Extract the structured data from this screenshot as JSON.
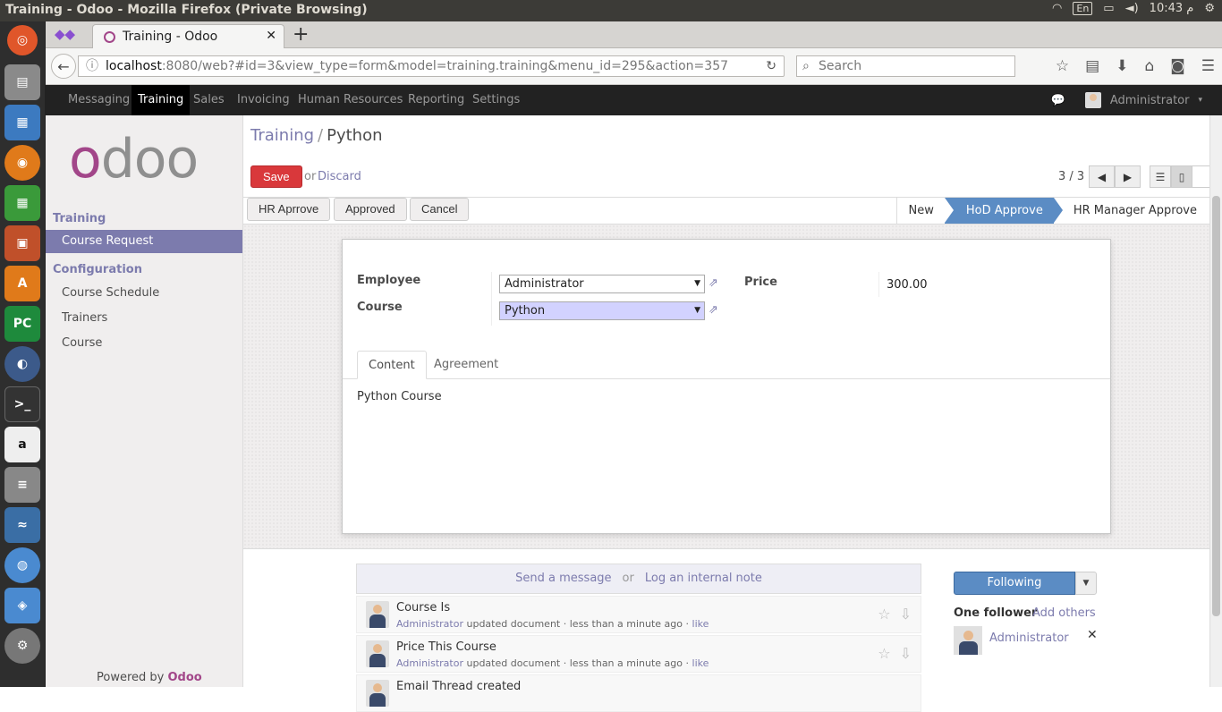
{
  "window_title": "Training - Odoo - Mozilla Firefox (Private Browsing)",
  "tray": {
    "lang": "En",
    "clock": "10:43 م"
  },
  "browser": {
    "tab_title": "Training - Odoo",
    "url_host": "localhost",
    "url_rest": ":8080/web?#id=3&view_type=form&model=training.training&menu_id=295&action=357",
    "search_placeholder": "Search"
  },
  "topbar": {
    "menus": [
      "Messaging",
      "Training",
      "Sales",
      "Invoicing",
      "Human Resources",
      "Reporting",
      "Settings"
    ],
    "active_menu": "Training",
    "user": "Administrator"
  },
  "sidebar": {
    "logo": "odoo",
    "sections": [
      {
        "title": "Training",
        "items": [
          "Course Request"
        ]
      },
      {
        "title": "Configuration",
        "items": [
          "Course Schedule",
          "Trainers",
          "Course"
        ]
      }
    ],
    "powered_prefix": "Powered by",
    "powered_brand": "Odoo"
  },
  "control_panel": {
    "breadcrumb_root": "Training",
    "breadcrumb_sep": "/",
    "breadcrumb_current": "Python",
    "save_label": "Save",
    "or_label": "or",
    "discard_label": "Discard",
    "pager": "3 / 3"
  },
  "workflow": {
    "buttons": [
      "HR Aprrove",
      "Approved",
      "Cancel"
    ],
    "stages": [
      "New",
      "HoD Approve",
      "HR Manager Approve"
    ],
    "active_stage": "HoD Approve"
  },
  "form": {
    "employee_label": "Employee",
    "employee_value": "Administrator",
    "course_label": "Course",
    "course_value": "Python",
    "price_label": "Price",
    "price_value": "300.00",
    "tabs": [
      "Content",
      "Agreement"
    ],
    "content_text": "Python Course"
  },
  "chatter": {
    "send_message": "Send a message",
    "or_label": "or",
    "log_note": "Log an internal note",
    "messages": [
      {
        "title": "Course Is",
        "author": "Administrator",
        "action": "updated document",
        "time": "less than a minute ago",
        "like": "like"
      },
      {
        "title": "Price This Course",
        "author": "Administrator",
        "action": "updated document",
        "time": "less than a minute ago",
        "like": "like"
      },
      {
        "title": "Email Thread created"
      }
    ],
    "following_label": "Following",
    "followers_title": "One follower",
    "add_others": "Add others",
    "follower_name": "Administrator"
  },
  "colors": {
    "brand": "#7c7bad",
    "save": "#d9383b",
    "stage_active": "#5b8cc4"
  }
}
